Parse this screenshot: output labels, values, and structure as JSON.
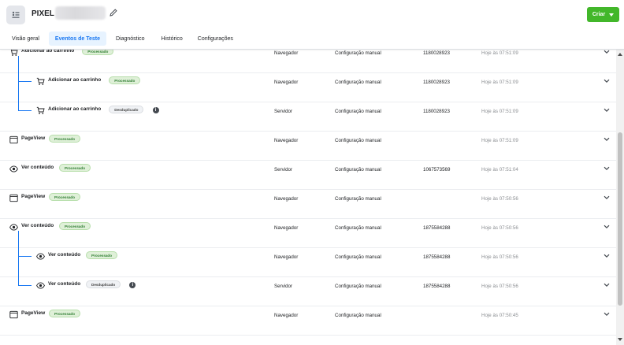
{
  "header": {
    "pixel_label": "PIXEL",
    "create_label": "Criar",
    "colors": {
      "accent": "#1877f2",
      "create": "#42b72a"
    }
  },
  "tabs": [
    {
      "label": "Visão geral",
      "active": false
    },
    {
      "label": "Eventos de Teste",
      "active": true
    },
    {
      "label": "Diagnóstico",
      "active": false
    },
    {
      "label": "Histórico",
      "active": false
    },
    {
      "label": "Configurações",
      "active": false
    }
  ],
  "events": [
    {
      "name": "Adicionar ao carrinho",
      "icon": "cart-icon",
      "status": "Processado",
      "status_type": "ok",
      "info": false,
      "child": false,
      "source": "Navegador",
      "method": "Configuração manual",
      "id": "1180028923",
      "time": "Hoje às 07:51:09"
    },
    {
      "name": "Adicionar ao carrinho",
      "icon": "cart-icon",
      "status": "Processado",
      "status_type": "ok",
      "info": false,
      "child": true,
      "source": "Navegador",
      "method": "Configuração manual",
      "id": "1180028923",
      "time": "Hoje às 07:51:09"
    },
    {
      "name": "Adicionar ao carrinho",
      "icon": "cart-icon",
      "status": "Desduplicado",
      "status_type": "dup",
      "info": true,
      "child": true,
      "source": "Servidor",
      "method": "Configuração manual",
      "id": "1180028923",
      "time": "Hoje às 07:51:09"
    },
    {
      "name": "PageView",
      "icon": "window-icon",
      "status": "Processado",
      "status_type": "ok",
      "info": false,
      "child": false,
      "source": "Navegador",
      "method": "Configuração manual",
      "id": "",
      "time": "Hoje às 07:51:09"
    },
    {
      "name": "Ver conteúdo",
      "icon": "eye-icon",
      "status": "Processado",
      "status_type": "ok",
      "info": false,
      "child": false,
      "source": "Servidor",
      "method": "Configuração manual",
      "id": "1067573569",
      "time": "Hoje às 07:51:04"
    },
    {
      "name": "PageView",
      "icon": "window-icon",
      "status": "Processado",
      "status_type": "ok",
      "info": false,
      "child": false,
      "source": "Navegador",
      "method": "Configuração manual",
      "id": "",
      "time": "Hoje às 07:50:56"
    },
    {
      "name": "Ver conteúdo",
      "icon": "eye-icon",
      "status": "Processado",
      "status_type": "ok",
      "info": false,
      "child": false,
      "source": "Navegador",
      "method": "Configuração manual",
      "id": "1875584288",
      "time": "Hoje às 07:50:56"
    },
    {
      "name": "Ver conteúdo",
      "icon": "eye-icon",
      "status": "Processado",
      "status_type": "ok",
      "info": false,
      "child": true,
      "source": "Navegador",
      "method": "Configuração manual",
      "id": "1875584288",
      "time": "Hoje às 07:50:56"
    },
    {
      "name": "Ver conteúdo",
      "icon": "eye-icon",
      "status": "Desduplicado",
      "status_type": "dup",
      "info": true,
      "child": true,
      "source": "Servidor",
      "method": "Configuração manual",
      "id": "1875584288",
      "time": "Hoje às 07:50:56"
    },
    {
      "name": "PageView",
      "icon": "window-icon",
      "status": "Processado",
      "status_type": "ok",
      "info": false,
      "child": false,
      "source": "Navegador",
      "method": "Configuração manual",
      "id": "",
      "time": "Hoje às 07:50:45"
    }
  ]
}
